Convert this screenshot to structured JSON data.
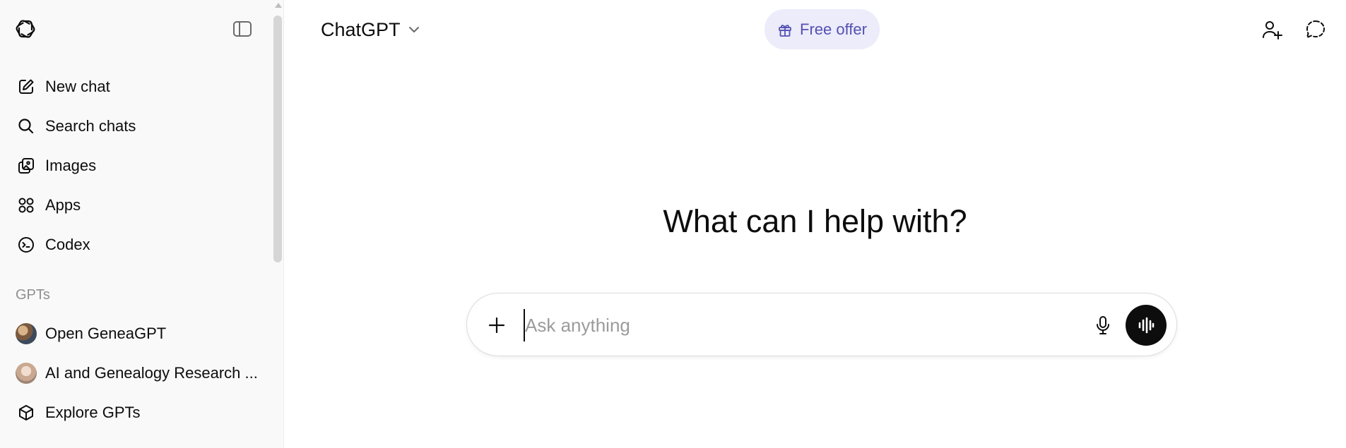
{
  "sidebar": {
    "toggle_label": "",
    "nav": [
      {
        "label": "New chat",
        "icon": "new-chat-icon"
      },
      {
        "label": "Search chats",
        "icon": "search-icon"
      },
      {
        "label": "Images",
        "icon": "images-icon"
      },
      {
        "label": "Apps",
        "icon": "apps-icon"
      },
      {
        "label": "Codex",
        "icon": "codex-icon"
      }
    ],
    "gpts_section_label": "GPTs",
    "gpts": [
      {
        "label": "Open GeneaGPT"
      },
      {
        "label": "AI and Genealogy Research ..."
      },
      {
        "label": "Explore GPTs",
        "icon": "explore-icon"
      }
    ]
  },
  "header": {
    "model_name": "ChatGPT",
    "offer_label": "Free offer"
  },
  "main": {
    "heading": "What can I help with?",
    "composer": {
      "placeholder": "Ask anything",
      "value": ""
    }
  },
  "colors": {
    "sidebar_bg": "#f9f9f9",
    "offer_bg": "#ececfa",
    "offer_text": "#5450b4",
    "voice_button": "#0d0d0d"
  }
}
